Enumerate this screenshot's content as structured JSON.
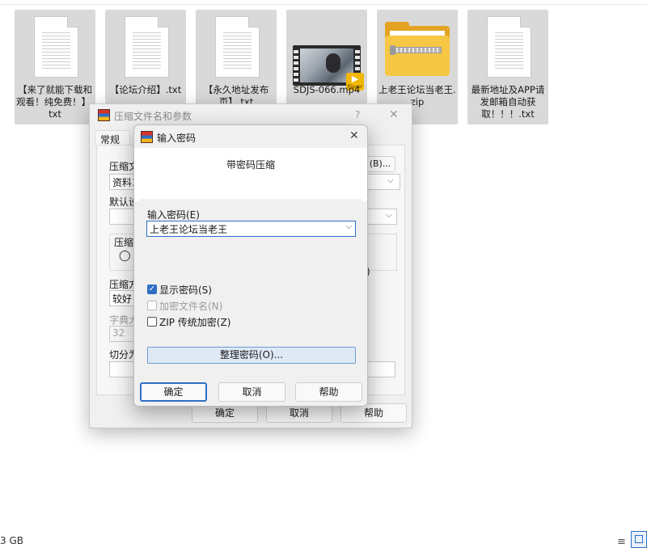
{
  "files": [
    {
      "name": "【来了就能下载和观看！纯免费！】.txt",
      "kind": "text",
      "icon": "text-file-icon"
    },
    {
      "name": "【论坛介绍】.txt",
      "kind": "text",
      "icon": "text-file-icon"
    },
    {
      "name": "【永久地址发布页】.txt",
      "kind": "text",
      "icon": "text-file-icon"
    },
    {
      "name": "SDJS-066.mp4",
      "kind": "video",
      "icon": "video-file-icon",
      "badge": "Player"
    },
    {
      "name": "上老王论坛当老王.zip",
      "kind": "zip",
      "icon": "zip-folder-icon"
    },
    {
      "name": "最新地址及APP请发邮箱自动获取！！！.txt",
      "kind": "text",
      "icon": "text-file-icon"
    }
  ],
  "compress_dialog": {
    "title": "压缩文件名和参数",
    "help": "?",
    "close": "✕",
    "tab": "常规",
    "archive_label": "压缩文",
    "archive_value": "资料3",
    "browse_label": "(B)...",
    "default_label": "默认设",
    "format_label": "压缩",
    "method_label": "压缩方",
    "method_value": "较好",
    "dict_label": "字典大",
    "dict_value": "32",
    "split_label": "切分为",
    "paren_fragment": ")",
    "ok": "确定",
    "cancel": "取消",
    "help_button": "帮助"
  },
  "password_dialog": {
    "title": "输入密码",
    "close": "✕",
    "heading": "带密码压缩",
    "enter_label": "输入密码(E)",
    "password_value": "上老王论坛当老王",
    "show_password": {
      "label": "显示密码(S)",
      "checked": true
    },
    "encrypt_names": {
      "label": "加密文件名(N)",
      "checked": false,
      "enabled": false
    },
    "zip_legacy": {
      "label": "ZIP 传统加密(Z)",
      "checked": false
    },
    "organize": "整理密码(O)...",
    "ok": "确定",
    "cancel": "取消",
    "help_button": "帮助"
  },
  "status": {
    "size": "3 GB"
  },
  "colors": {
    "accent": "#2d6fc4",
    "tile_selected": "#d9d9d9",
    "dialog_bg": "#f0f0f0"
  }
}
